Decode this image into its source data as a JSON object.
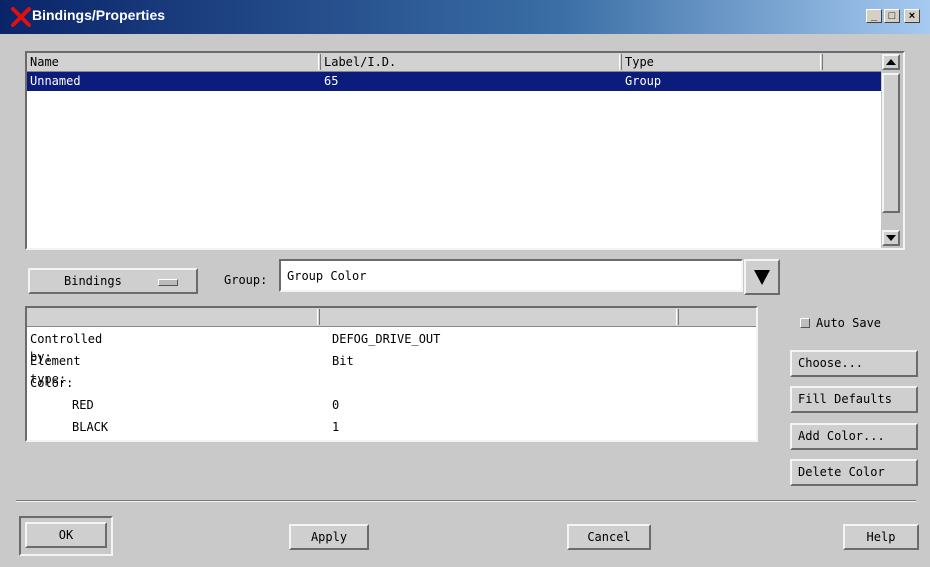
{
  "window": {
    "title": "Bindings/Properties",
    "controls": {
      "minimize": "_",
      "maximize": "□",
      "close": "×"
    }
  },
  "objects_list": {
    "columns": [
      "Name",
      "Label/I.D.",
      "Type"
    ],
    "rows": [
      {
        "name": "Unnamed",
        "label_id": "65",
        "type": "Group",
        "selected": true
      }
    ]
  },
  "mode_menu": {
    "value": "Bindings"
  },
  "group": {
    "label": "Group:",
    "value": "Group Color"
  },
  "properties": {
    "rows": [
      {
        "key": "Controlled by:",
        "value": "DEFOG_DRIVE_OUT",
        "indent": false
      },
      {
        "key": "Element type:",
        "value": "Bit",
        "indent": false
      },
      {
        "key": "Color:",
        "value": "",
        "indent": false
      },
      {
        "key": "RED",
        "value": "0",
        "indent": true
      },
      {
        "key": "BLACK",
        "value": "1",
        "indent": true
      }
    ]
  },
  "side": {
    "auto_save_label": "Auto Save",
    "choose_label": "Choose...",
    "fill_defaults_label": "Fill Defaults",
    "add_color_label": "Add Color...",
    "delete_color_label": "Delete Color"
  },
  "footer": {
    "ok_label": "OK",
    "apply_label": "Apply",
    "cancel_label": "Cancel",
    "help_label": "Help"
  },
  "colors": {
    "title_bar": "#0a246a",
    "selection": "#0c1c7c",
    "window_bg": "#c9c9c9"
  }
}
